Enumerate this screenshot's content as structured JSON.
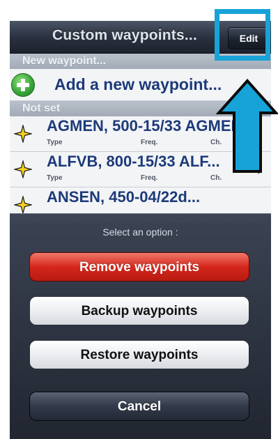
{
  "navbar": {
    "title": "Custom waypoints...",
    "edit_label": "Edit"
  },
  "list": {
    "section_new": "New waypoint...",
    "add_label": "Add a new waypoint...",
    "section_not_set": "Not set",
    "waypoints": [
      {
        "name": "AGMEN, 500-15/33 AGMEN",
        "type_label": "Type",
        "freq_label": "Freq.",
        "ch_label": "Ch."
      },
      {
        "name": "ALFVB, 800-15/33 ALF...",
        "type_label": "Type",
        "freq_label": "Freq.",
        "ch_label": "Ch."
      },
      {
        "name": "ANSEN, 450-04/22d...",
        "type_label": "",
        "freq_label": "",
        "ch_label": ""
      }
    ],
    "chevron": "›"
  },
  "sheet": {
    "title": "Select an option :",
    "remove_label": "Remove waypoints",
    "backup_label": "Backup waypoints",
    "restore_label": "Restore waypoints",
    "cancel_label": "Cancel"
  },
  "colors": {
    "annotation": "#17a3d8",
    "remove_button": "#d5271c",
    "link_text": "#1c3a7a",
    "star": "#f5d021"
  },
  "icons": {
    "add": "plus-circle-icon",
    "waypoint": "star-icon",
    "annotation": "arrow-up-icon"
  }
}
